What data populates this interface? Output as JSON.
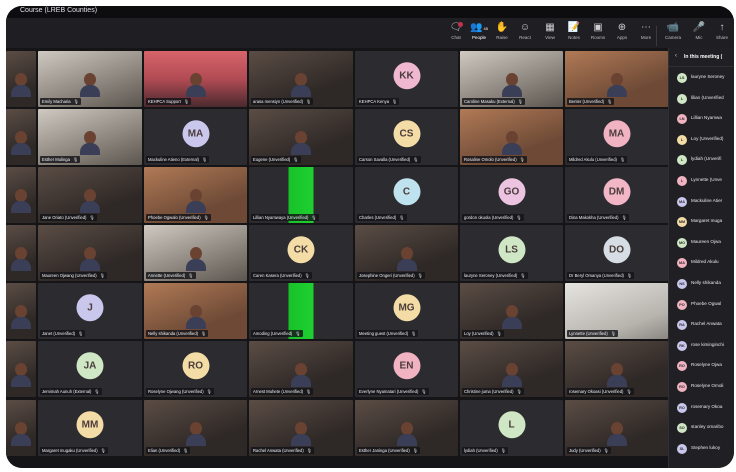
{
  "window": {
    "title": "Course (LREB Counties)"
  },
  "toolbar": {
    "items": [
      {
        "label": "Chat",
        "icon": "chat-icon"
      },
      {
        "label": "People",
        "icon": "people-icon",
        "count": "45"
      },
      {
        "label": "Raise",
        "icon": "raise-hand-icon"
      },
      {
        "label": "React",
        "icon": "react-icon"
      },
      {
        "label": "View",
        "icon": "view-icon"
      },
      {
        "label": "Notes",
        "icon": "notes-icon"
      },
      {
        "label": "Rooms",
        "icon": "rooms-icon"
      },
      {
        "label": "Apps",
        "icon": "apps-icon"
      },
      {
        "label": "More",
        "icon": "more-icon"
      },
      {
        "label": "Camera",
        "icon": "camera-icon"
      },
      {
        "label": "Mic",
        "icon": "mic-icon"
      },
      {
        "label": "Share",
        "icon": "share-icon"
      }
    ]
  },
  "tiles": [
    {
      "name": "",
      "initials": "",
      "video": true
    },
    {
      "name": "Emily Macharia",
      "initials": "",
      "video": true
    },
    {
      "name": "KEHPCA Support",
      "initials": "",
      "video": true
    },
    {
      "name": "arasa mensiyn (Unverified)",
      "initials": "",
      "video": true
    },
    {
      "name": "KEHPCA Kenya",
      "initials": "KK",
      "avatar_color": "#f0b8d0",
      "video": false
    },
    {
      "name": "Caroline Masaku (External)",
      "initials": "",
      "video": true
    },
    {
      "name": "Benter (Unverified)",
      "initials": "",
      "video": true
    },
    {
      "name": "",
      "initials": "",
      "video": true
    },
    {
      "name": "Esther Mulinga",
      "initials": "",
      "video": true
    },
    {
      "name": "Mackuline Atieno (External)",
      "initials": "MA",
      "avatar_color": "#c9c7ec",
      "video": false
    },
    {
      "name": "Eugene (Unverified)",
      "initials": "",
      "video": true
    },
    {
      "name": "Carson Savalla (Unverified)",
      "initials": "CS",
      "avatar_color": "#f3dca5",
      "video": false
    },
    {
      "name": "Rosaline Omolo (Unverified)",
      "initials": "",
      "video": true
    },
    {
      "name": "Mildred Akulu (Unverified)",
      "initials": "MA",
      "avatar_color": "#f1b3c2",
      "video": false
    },
    {
      "name": "",
      "initials": "",
      "video": true
    },
    {
      "name": "Jane Oriato (Unverified)",
      "initials": "",
      "video": true
    },
    {
      "name": "Phoebe Ogwalo (Unverified)",
      "initials": "",
      "video": true
    },
    {
      "name": "Lillian Nyamwaya (Unverified)",
      "initials": "",
      "video": true
    },
    {
      "name": "Charles (Unverified)",
      "initials": "C",
      "avatar_color": "#bfe3ee",
      "video": false
    },
    {
      "name": "gordon okuola (Unverified)",
      "initials": "GO",
      "avatar_color": "#ecc3e0",
      "video": false
    },
    {
      "name": "Dina Makokha (Unverified)",
      "initials": "DM",
      "avatar_color": "#f2b6c6",
      "video": false
    },
    {
      "name": "",
      "initials": "",
      "video": true
    },
    {
      "name": "Maureen Ojwang (Unverified)",
      "initials": "",
      "video": true
    },
    {
      "name": "Annette (Unverified)",
      "initials": "",
      "video": true
    },
    {
      "name": "Caren Kasera (Unverified)",
      "initials": "CK",
      "avatar_color": "#f3dca5",
      "video": false
    },
    {
      "name": "Josephine Ongeri (Unverified)",
      "initials": "",
      "video": true
    },
    {
      "name": "lauryne Seroney (Unverified)",
      "initials": "LS",
      "avatar_color": "#cfe7c4",
      "video": false
    },
    {
      "name": "Dr Beryl Omanya (Unverified)",
      "initials": "DO",
      "avatar_color": "#d6dde4",
      "video": false
    },
    {
      "name": "",
      "initials": "",
      "video": true
    },
    {
      "name": "Janet (Unverified)",
      "initials": "J",
      "avatar_color": "#c9c7ec",
      "video": false
    },
    {
      "name": "Nelly shikanda (Unverified)",
      "initials": "",
      "video": true
    },
    {
      "name": "Amoding (Unverified)",
      "initials": "",
      "video": true
    },
    {
      "name": "Meeting guest (Unverified)",
      "initials": "MG",
      "avatar_color": "#f3dca5",
      "video": false
    },
    {
      "name": "Loy (Unverified)",
      "initials": "",
      "video": true
    },
    {
      "name": "Lynnette (Unverified)",
      "initials": "",
      "video": true
    },
    {
      "name": "",
      "initials": "",
      "video": true
    },
    {
      "name": "Jemimah Aunuh (External)",
      "initials": "JA",
      "avatar_color": "#cfe7c4",
      "video": false
    },
    {
      "name": "Roselyne Ojwang (Unverified)",
      "initials": "RO",
      "avatar_color": "#f3dca5",
      "video": false
    },
    {
      "name": "Arnest Muhete (Unverified)",
      "initials": "",
      "video": true
    },
    {
      "name": "Everlyne Nyamatari (Unverified)",
      "initials": "EN",
      "avatar_color": "#f1b3c2",
      "video": false
    },
    {
      "name": "Christine juma (Unverified)",
      "initials": "",
      "video": true
    },
    {
      "name": "rosemary Okoasi (Unverified)",
      "initials": "",
      "video": true
    },
    {
      "name": "",
      "initials": "",
      "video": true
    },
    {
      "name": "Margaret mugaku (Unverified)",
      "initials": "MM",
      "avatar_color": "#f3dca5",
      "video": false
    },
    {
      "name": "Elian (Unverified)",
      "initials": "",
      "video": true
    },
    {
      "name": "Rachel Anwata (Unverified)",
      "initials": "",
      "video": true
    },
    {
      "name": "Esther Janinga (Unverified)",
      "initials": "",
      "video": true
    },
    {
      "name": "lydiah (Unverified)",
      "initials": "L",
      "avatar_color": "#cfe7c4",
      "video": false
    },
    {
      "name": "Judy (Unverified)",
      "initials": "",
      "video": true
    }
  ],
  "panel": {
    "title": "In this meeting (",
    "people": [
      {
        "name": "lauryne Seroney",
        "initials": "LS",
        "color": "#cfe7c4"
      },
      {
        "name": "lilian (Unverified",
        "initials": "L",
        "color": "#cfe7c4"
      },
      {
        "name": "Lillian Nyamwa",
        "initials": "LN",
        "color": "#f1b3c2"
      },
      {
        "name": "Loy (Unverified)",
        "initials": "L",
        "color": "#f3dca5"
      },
      {
        "name": "lydiah (Unverifi",
        "initials": "L",
        "color": "#cfe7c4"
      },
      {
        "name": "Lynnette (Unve",
        "initials": "L",
        "color": "#f1b3c2"
      },
      {
        "name": "Mackuline Atier",
        "initials": "MA",
        "color": "#c9c7ec"
      },
      {
        "name": "Margaret muga",
        "initials": "MM",
        "color": "#f3dca5"
      },
      {
        "name": "Maureen Ojwa",
        "initials": "MO",
        "color": "#cfe7c4"
      },
      {
        "name": "Mildred Akulu",
        "initials": "MA",
        "color": "#f1b3c2"
      },
      {
        "name": "Nelly shikanda",
        "initials": "NS",
        "color": "#c9c7ec"
      },
      {
        "name": "Phoebe Ogwal",
        "initials": "PO",
        "color": "#f1b3c2"
      },
      {
        "name": "Rachel Anwata",
        "initials": "RA",
        "color": "#c9c7ec"
      },
      {
        "name": "rose kiminginchi",
        "initials": "RK",
        "color": "#c9c7ec"
      },
      {
        "name": "Roselyne Ojwa",
        "initials": "RO",
        "color": "#f1b3c2"
      },
      {
        "name": "Roselyne Omoli",
        "initials": "RO",
        "color": "#f1b3c2"
      },
      {
        "name": "rosemary Okoa",
        "initials": "RO",
        "color": "#c9c7ec"
      },
      {
        "name": "stanley omaribo",
        "initials": "SO",
        "color": "#cfe7c4"
      },
      {
        "name": "Stephen lukoy",
        "initials": "SL",
        "color": "#c9c7ec"
      }
    ]
  }
}
